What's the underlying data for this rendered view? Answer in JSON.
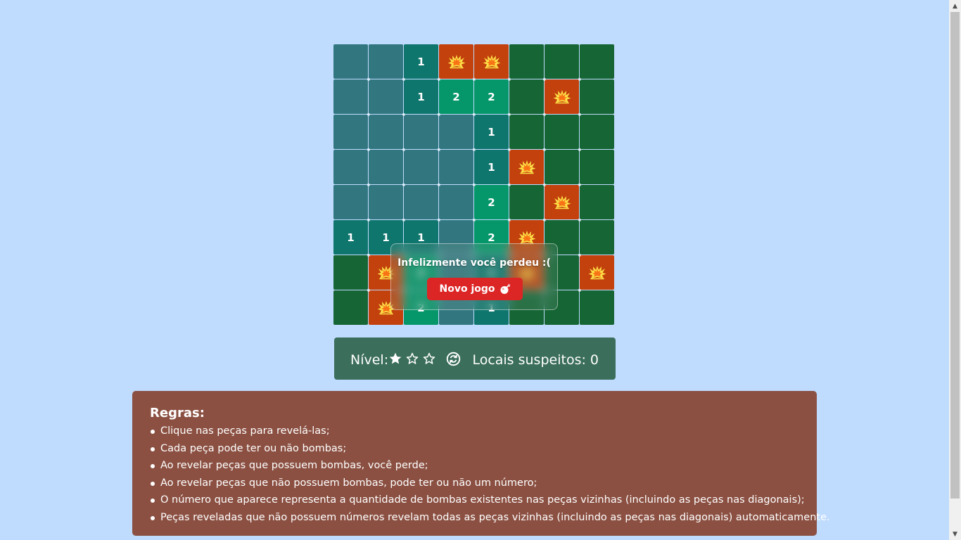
{
  "board": {
    "rows": 8,
    "cols": 8,
    "cells": [
      [
        "empty",
        "empty",
        "1",
        "bomb",
        "bomb",
        "hidden",
        "hidden",
        "hidden"
      ],
      [
        "empty",
        "empty",
        "1",
        "2",
        "2",
        "hidden",
        "bomb",
        "hidden"
      ],
      [
        "empty",
        "empty",
        "empty",
        "empty",
        "1",
        "hidden",
        "hidden",
        "hidden"
      ],
      [
        "empty",
        "empty",
        "empty",
        "empty",
        "1",
        "bomb",
        "hidden",
        "hidden"
      ],
      [
        "empty",
        "empty",
        "empty",
        "empty",
        "2",
        "hidden",
        "bomb",
        "hidden"
      ],
      [
        "1",
        "1",
        "1",
        "empty",
        "2",
        "bomb",
        "hidden",
        "hidden"
      ],
      [
        "hidden",
        "bomb",
        "2",
        "empty",
        "1",
        "bomb",
        "hidden",
        "bomb"
      ],
      [
        "hidden",
        "bomb",
        "2",
        "empty",
        "1",
        "hidden",
        "hidden",
        "hidden"
      ]
    ]
  },
  "overlay": {
    "message": "Infelizmente você perdeu :(",
    "new_game_label": "Novo jogo",
    "new_game_icon": "bomb-icon"
  },
  "status": {
    "level_label": "Nível:",
    "level_stars_filled": 1,
    "level_stars_total": 3,
    "reset_icon": "reset-icon",
    "suspects_label": "Locais suspeitos: 0"
  },
  "rules": {
    "title": "Regras:",
    "items": [
      "Clique nas peças para revelá-las;",
      "Cada peça pode ter ou não bombas;",
      "Ao revelar peças que possuem bombas, você perde;",
      "Ao revelar peças que não possuem bombas, pode ter ou não um número;",
      "O número que aparece representa a quantidade de bombas existentes nas peças vizinhas (incluindo as peças nas diagonais);",
      "Peças reveladas que não possuem números revelam todas as peças vizinhas (incluindo as peças nas diagonais) automaticamente."
    ]
  },
  "colors": {
    "page_background": "#bfdbfe",
    "hidden_cell": "#166534",
    "empty_cell": "#327780",
    "number_1_cell": "#0f766e",
    "number_2_cell": "#059669",
    "bomb_cell": "#c2410c",
    "new_game_button": "#dc2626",
    "status_bar": "#3b6e5b",
    "rules_panel": "#8b5042"
  }
}
